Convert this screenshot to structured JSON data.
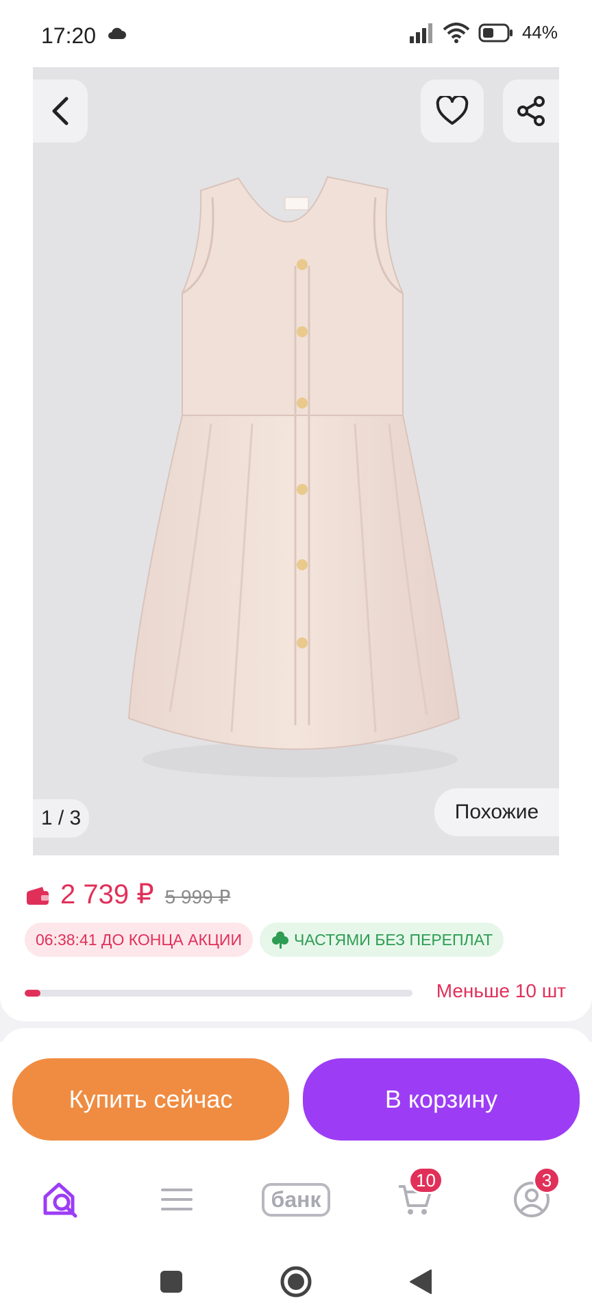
{
  "status_bar": {
    "time": "17:20",
    "battery": "44%",
    "icons": [
      "cloud-icon",
      "signal-icon",
      "wifi-icon",
      "battery-icon"
    ]
  },
  "product": {
    "gallery": {
      "page_indicator": "1 / 3",
      "similar_label": "Похожие"
    },
    "price": {
      "current": "2 739 ₽",
      "old": "5 999 ₽"
    },
    "badges": {
      "timer": "06:38:41 ДО КОНЦА АКЦИИ",
      "installments": "ЧАСТЯМИ БЕЗ ПЕРЕПЛАТ"
    },
    "stock": {
      "label": "Меньше 10 шт",
      "fill_fraction": 0.04
    }
  },
  "actions": {
    "buy_now": "Купить сейчас",
    "add_to_cart": "В корзину"
  },
  "bottom_nav": {
    "bank_label": "банк",
    "cart_count": "10",
    "profile_count": "3"
  },
  "colors": {
    "accent_purple": "#9c3df5",
    "buy_orange": "#ef8c42",
    "price_red": "#e0305a",
    "installments_green": "#2e9c52"
  }
}
